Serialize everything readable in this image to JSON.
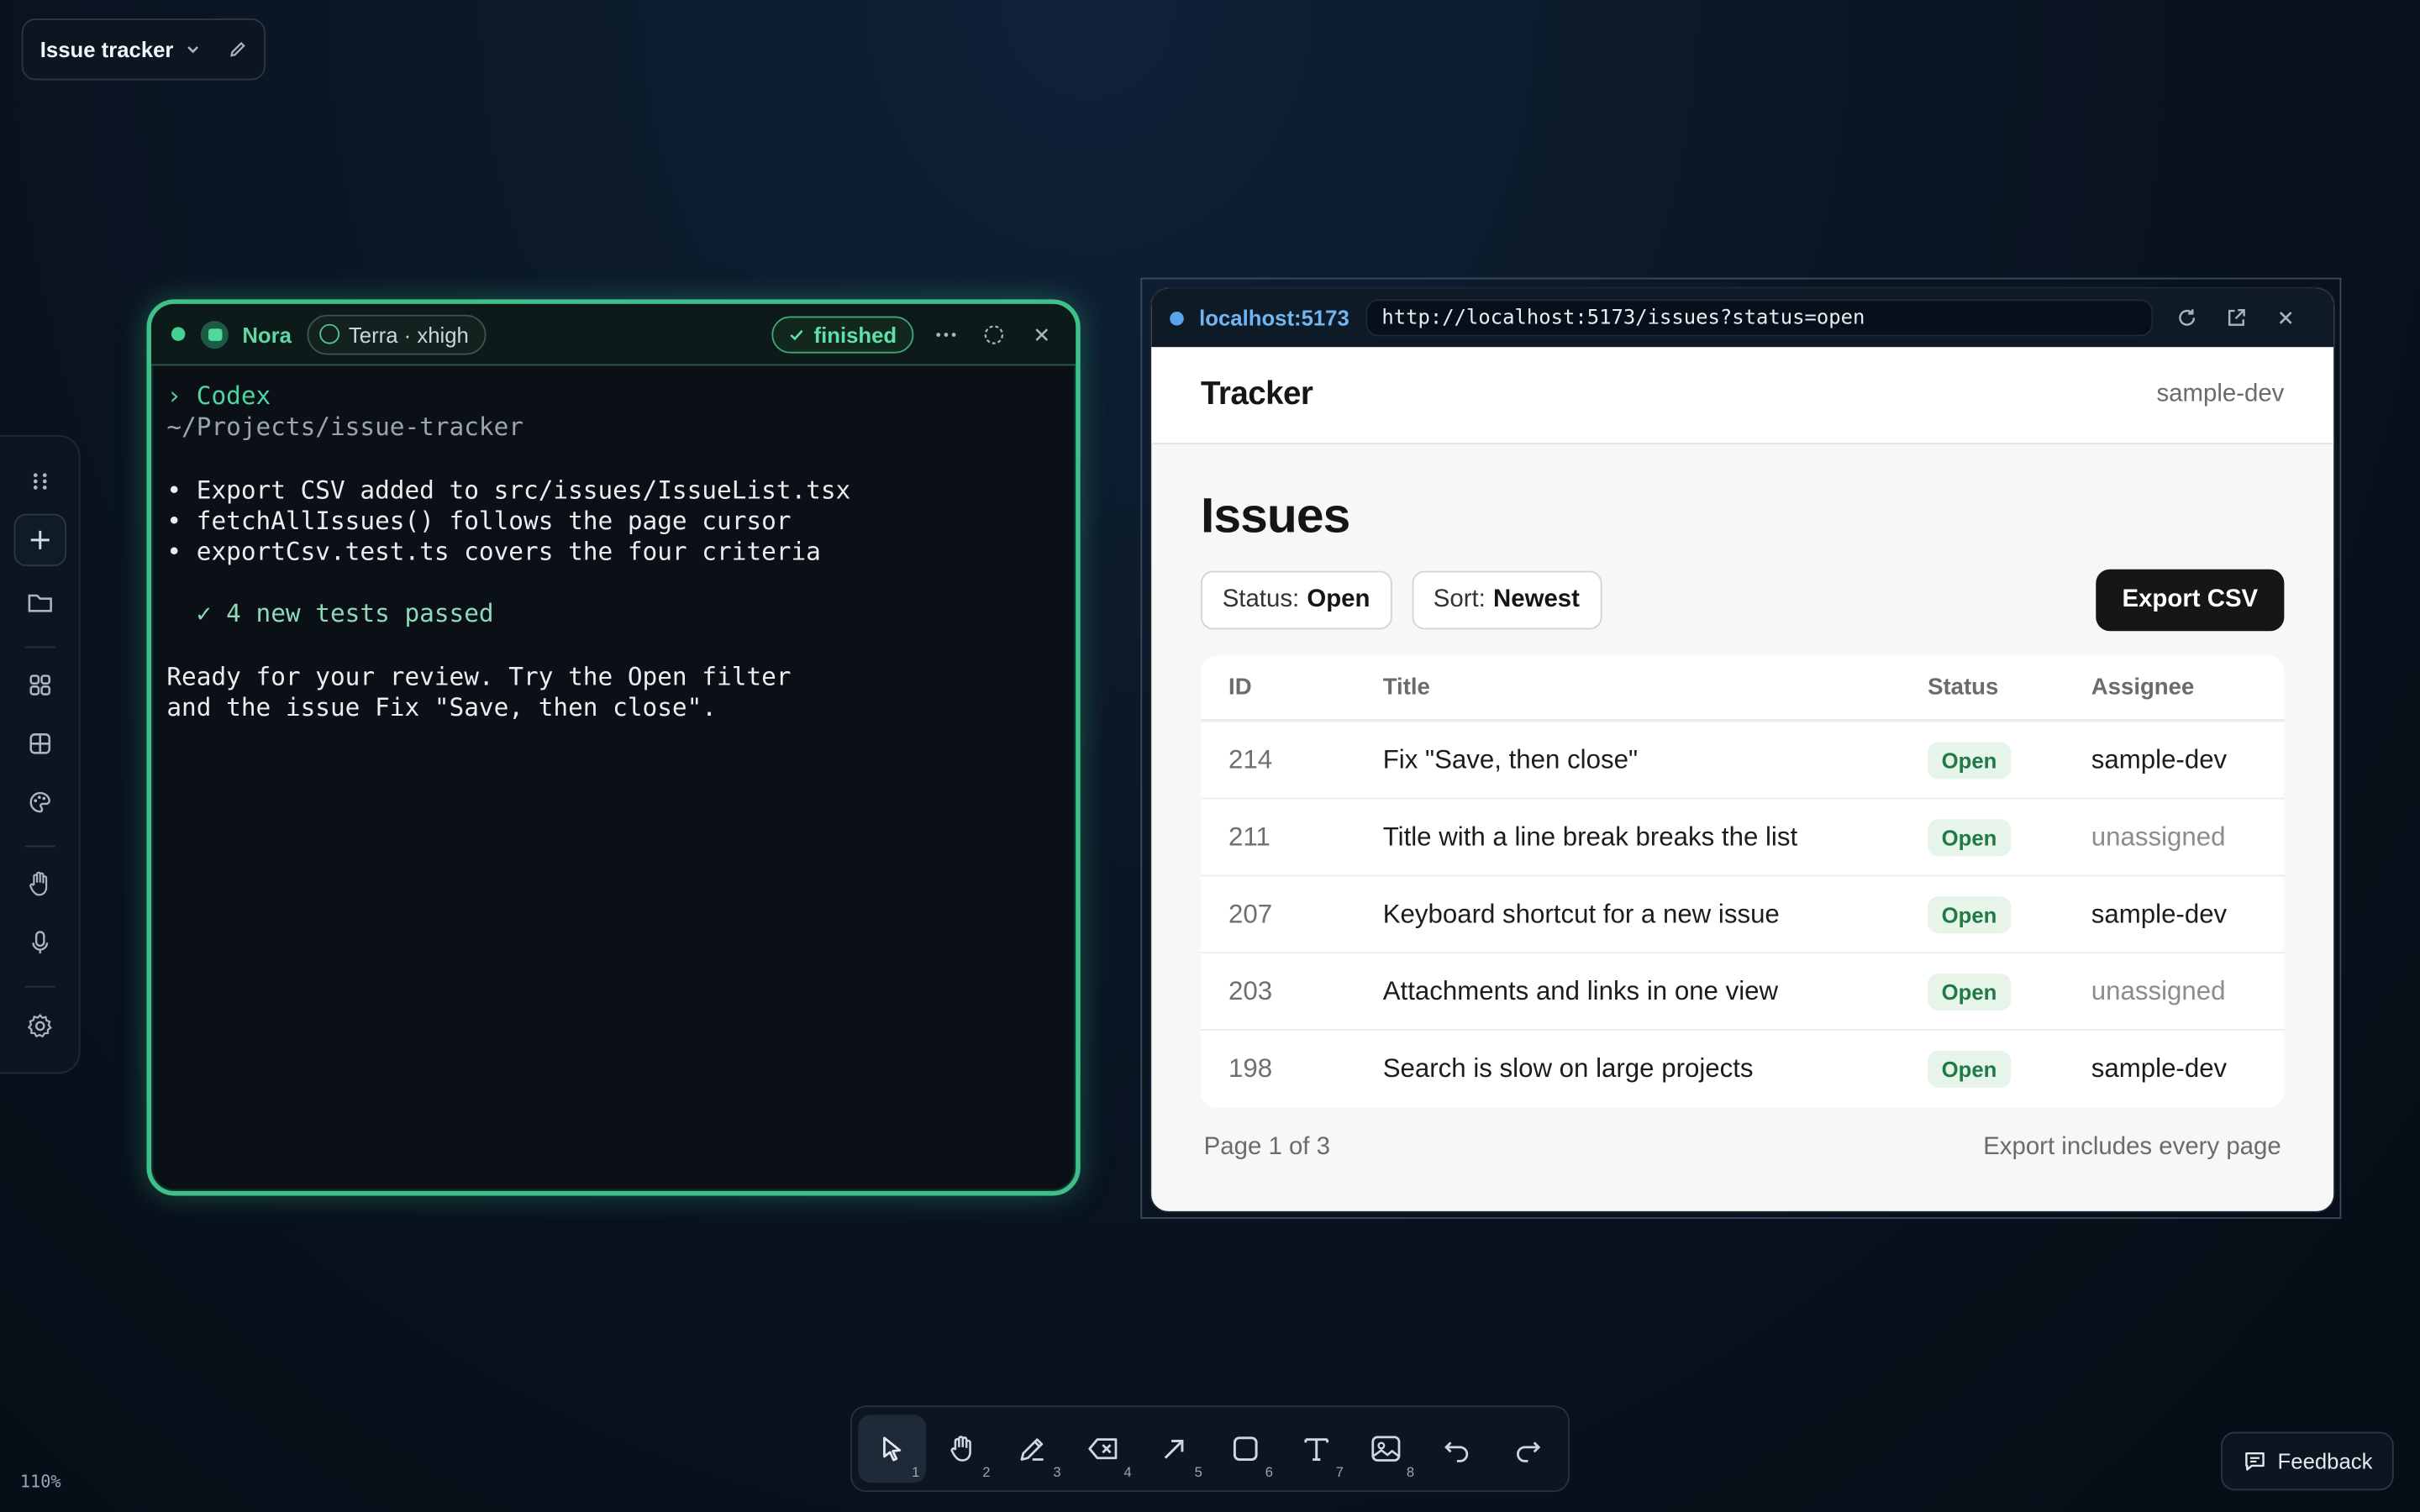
{
  "workspace": {
    "name": "Issue tracker",
    "zoom": "110%"
  },
  "terminal": {
    "user": "Nora",
    "model": "Terra · xhigh",
    "status": "finished",
    "lines": {
      "prompt": "› Codex",
      "path": "~/Projects/issue-tracker",
      "b1": "• Export CSV added to src/issues/IssueList.tsx",
      "b2": "• fetchAllIssues() follows the page cursor",
      "b3": "• exportCsv.test.ts covers the four criteria",
      "pass": "  ✓ 4 new tests passed",
      "r1": "Ready for your review. Try the Open filter",
      "r2": "and the issue Fix \"Save, then close\"."
    }
  },
  "browser": {
    "host": "localhost:5173",
    "url": "http://localhost:5173/issues?status=open",
    "app": {
      "brand": "Tracker",
      "user": "sample-dev",
      "heading": "Issues",
      "filters": {
        "status_label": "Status:",
        "status_value": "Open",
        "sort_label": "Sort:",
        "sort_value": "Newest"
      },
      "export_button": "Export CSV",
      "columns": [
        "ID",
        "Title",
        "Status",
        "Assignee"
      ],
      "rows": [
        {
          "id": "214",
          "title": "Fix \"Save, then close\"",
          "status": "Open",
          "assignee": "sample-dev"
        },
        {
          "id": "211",
          "title": "Title with a line break breaks the list",
          "status": "Open",
          "assignee": "unassigned"
        },
        {
          "id": "207",
          "title": "Keyboard shortcut for a new issue",
          "status": "Open",
          "assignee": "sample-dev"
        },
        {
          "id": "203",
          "title": "Attachments and links in one view",
          "status": "Open",
          "assignee": "unassigned"
        },
        {
          "id": "198",
          "title": "Search is slow on large projects",
          "status": "Open",
          "assignee": "sample-dev"
        }
      ],
      "page_info": "Page 1 of 3",
      "export_note": "Export includes every page"
    }
  },
  "toolbar": {
    "tools": [
      {
        "name": "select-tool",
        "num": "1",
        "icon": "cursor-icon"
      },
      {
        "name": "hand-tool",
        "num": "2",
        "icon": "hand-icon"
      },
      {
        "name": "draw-tool",
        "num": "3",
        "icon": "pencil-icon"
      },
      {
        "name": "eraser-tool",
        "num": "4",
        "icon": "eraser-icon"
      },
      {
        "name": "arrow-tool",
        "num": "5",
        "icon": "arrow-icon"
      },
      {
        "name": "rectangle-tool",
        "num": "6",
        "icon": "rectangle-icon"
      },
      {
        "name": "text-tool",
        "num": "7",
        "icon": "text-icon"
      },
      {
        "name": "image-tool",
        "num": "8",
        "icon": "image-icon"
      }
    ]
  },
  "feedback": {
    "label": "Feedback"
  }
}
